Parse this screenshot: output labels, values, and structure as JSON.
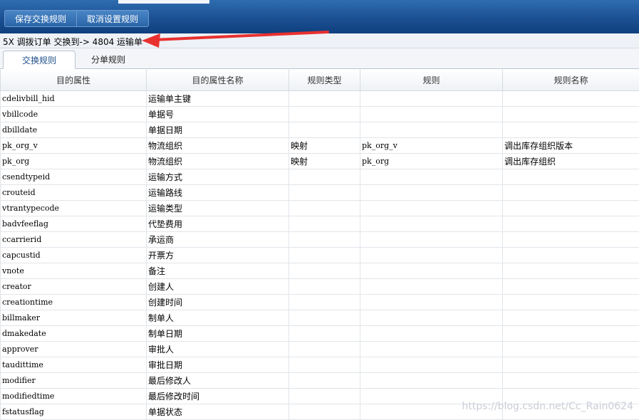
{
  "toolbar": {
    "save_label": "保存交换规则",
    "cancel_label": "取消设置规则"
  },
  "info_line": "5X 调拨订单 交换到-> 4804 运输单",
  "tabs": [
    {
      "label": "交换规则",
      "active": true
    },
    {
      "label": "分单规则",
      "active": false
    }
  ],
  "table": {
    "columns": [
      "目的属性",
      "目的属性名称",
      "规则类型",
      "规则",
      "规则名称"
    ],
    "rows": [
      [
        "cdelivbill_hid",
        "运输单主键",
        "",
        "",
        ""
      ],
      [
        "vbillcode",
        "单据号",
        "",
        "",
        ""
      ],
      [
        "dbilldate",
        "单据日期",
        "",
        "",
        ""
      ],
      [
        "pk_org_v",
        "物流组织",
        "映射",
        "pk_org_v",
        "调出库存组织版本"
      ],
      [
        "pk_org",
        "物流组织",
        "映射",
        "pk_org",
        "调出库存组织"
      ],
      [
        "csendtypeid",
        "运输方式",
        "",
        "",
        ""
      ],
      [
        "crouteid",
        "运输路线",
        "",
        "",
        ""
      ],
      [
        "vtrantypecode",
        "运输类型",
        "",
        "",
        ""
      ],
      [
        "badvfeeflag",
        "代垫费用",
        "",
        "",
        ""
      ],
      [
        "ccarrierid",
        "承运商",
        "",
        "",
        ""
      ],
      [
        "capcustid",
        "开票方",
        "",
        "",
        ""
      ],
      [
        "vnote",
        "备注",
        "",
        "",
        ""
      ],
      [
        "creator",
        "创建人",
        "",
        "",
        ""
      ],
      [
        "creationtime",
        "创建时间",
        "",
        "",
        ""
      ],
      [
        "billmaker",
        "制单人",
        "",
        "",
        ""
      ],
      [
        "dmakedate",
        "制单日期",
        "",
        "",
        ""
      ],
      [
        "approver",
        "审批人",
        "",
        "",
        ""
      ],
      [
        "taudittime",
        "审批日期",
        "",
        "",
        ""
      ],
      [
        "modifier",
        "最后修改人",
        "",
        "",
        ""
      ],
      [
        "modifiedtime",
        "最后修改时间",
        "",
        "",
        ""
      ],
      [
        "fstatusflag",
        "单据状态",
        "",
        "",
        ""
      ]
    ]
  },
  "watermark": "https://blog.csdn.net/Cc_Rain0624",
  "colors": {
    "header_blue": "#1e5598",
    "arrow_red": "#e8312f"
  }
}
